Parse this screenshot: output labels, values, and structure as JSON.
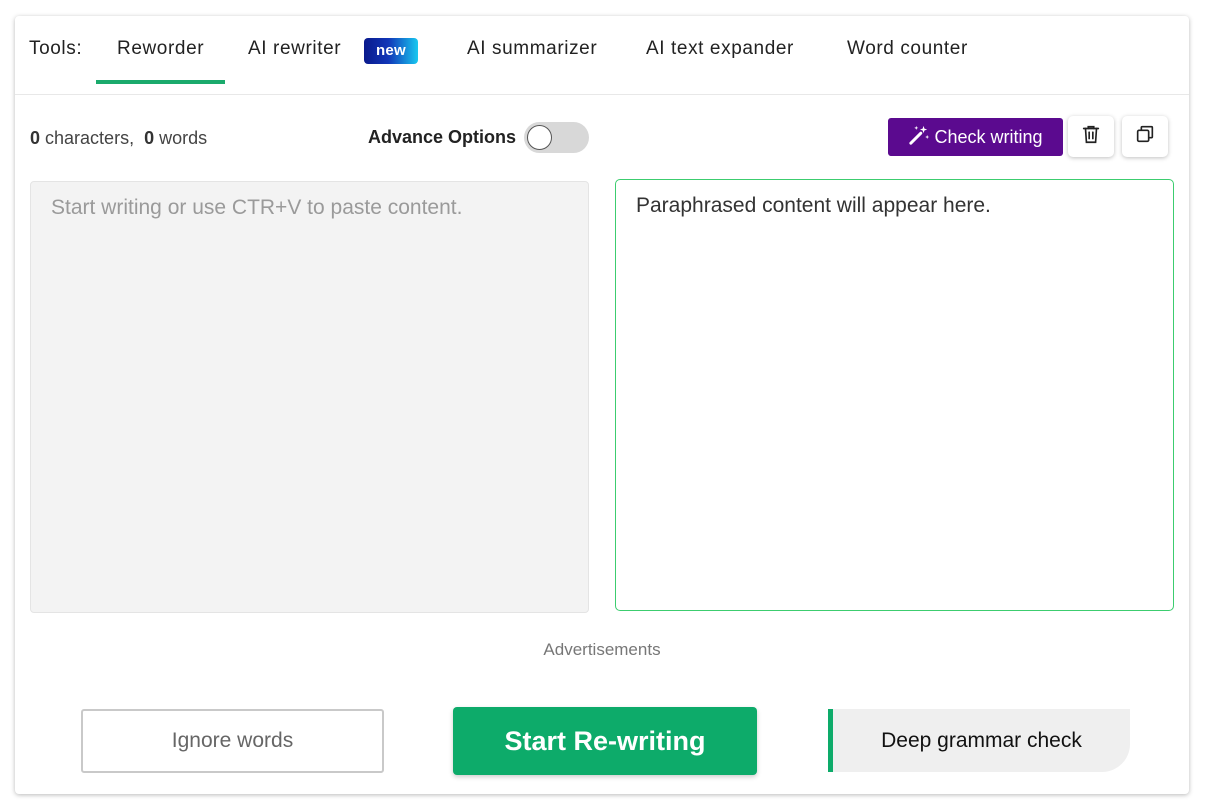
{
  "tabs": {
    "label": "Tools:",
    "items": [
      {
        "label": "Reworder",
        "active": true
      },
      {
        "label": "AI rewriter",
        "badge": "new"
      },
      {
        "label": "AI summarizer"
      },
      {
        "label": "AI text expander"
      },
      {
        "label": "Word counter"
      }
    ]
  },
  "toolbar": {
    "char_count": "0",
    "char_label": "characters,",
    "word_count": "0",
    "word_label": "words",
    "advance_options_label": "Advance Options",
    "advance_options_enabled": false,
    "check_writing_label": "Check writing",
    "check_writing_icon": "magic-wand-icon",
    "delete_icon": "trash-icon",
    "copy_icon": "copy-icon"
  },
  "editor": {
    "input_placeholder": "Start writing or use CTR+V to paste content.",
    "output_placeholder": "Paraphrased content will appear here."
  },
  "ads": {
    "label": "Advertisements"
  },
  "actions": {
    "ignore_words_label": "Ignore words",
    "start_label": "Start Re-writing",
    "deep_grammar_label": "Deep grammar check"
  },
  "colors": {
    "accent_green": "#0dab6a",
    "check_purple": "#5b0a8f",
    "output_border": "#3ccd6f"
  }
}
